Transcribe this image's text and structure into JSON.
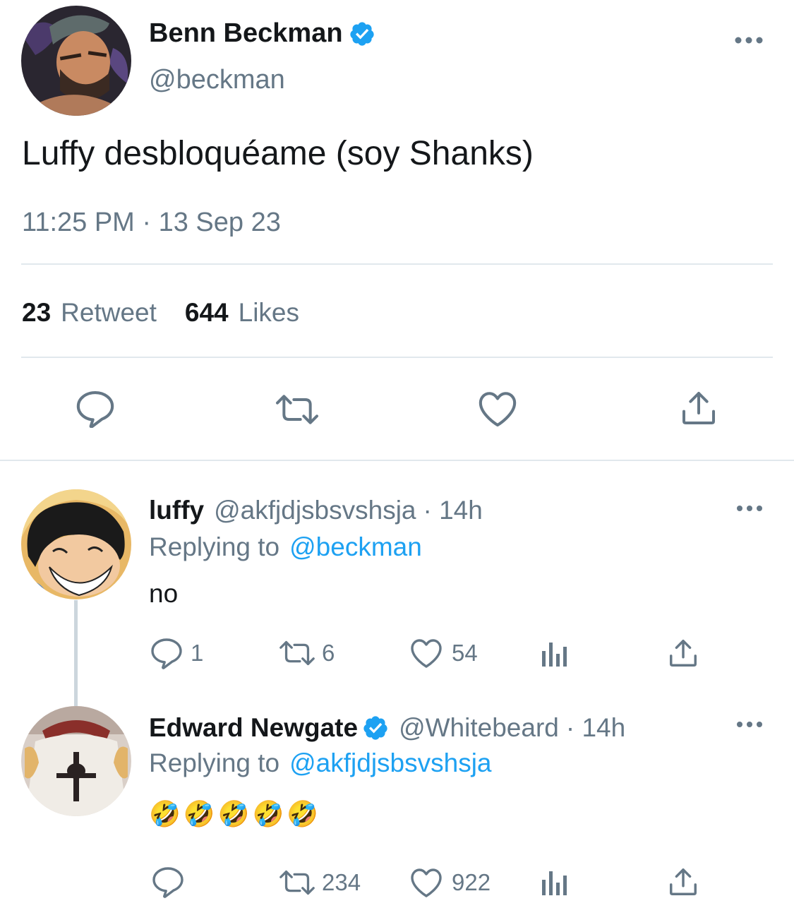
{
  "main_tweet": {
    "display_name": "Benn Beckman",
    "handle": "@beckman",
    "text": "Luffy desbloquéame (soy Shanks)",
    "timestamp": "11:25 PM · 13 Sep 23",
    "retweets_count": "23",
    "retweets_label": "Retweet",
    "likes_count": "644",
    "likes_label": "Likes",
    "verified": true
  },
  "replies": [
    {
      "display_name": "luffy",
      "handle": "@akfjdjsbsvshsja",
      "time": "· 14h",
      "replying_prefix": "Replying to",
      "replying_to": "@beckman",
      "text": "no",
      "reply_count": "1",
      "retweet_count": "6",
      "like_count": "54",
      "verified": false
    },
    {
      "display_name": "Edward Newgate",
      "handle": "@Whitebeard",
      "time": "· 14h",
      "replying_prefix": "Replying to",
      "replying_to": "@akfjdjsbsvshsja",
      "text": "🤣🤣🤣🤣🤣",
      "reply_count": "",
      "retweet_count": "234",
      "like_count": "922",
      "verified": true
    }
  ],
  "colors": {
    "accent": "#1da1f2",
    "text": "#14171a",
    "muted": "#657786",
    "divider": "#e1e8ed"
  }
}
